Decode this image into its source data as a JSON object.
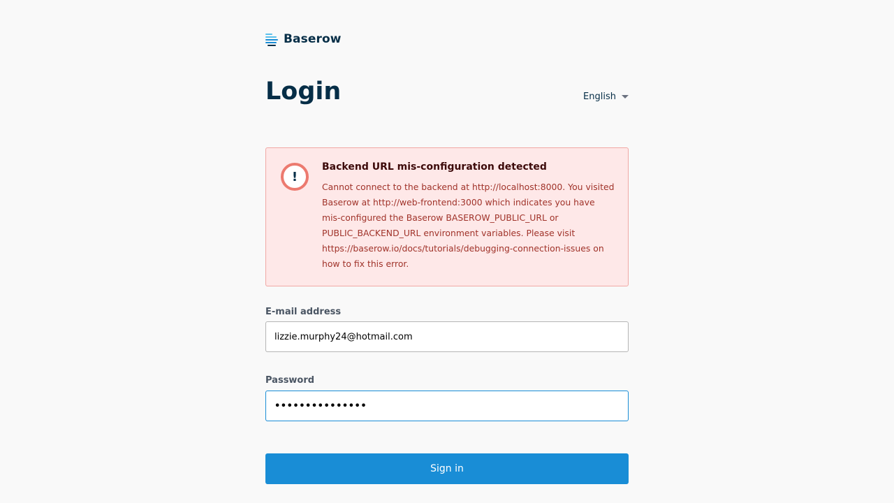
{
  "brand": {
    "name": "Baserow",
    "colors": [
      "#5bc0eb",
      "#198dd6",
      "#062e47"
    ]
  },
  "page": {
    "title": "Login"
  },
  "language": {
    "selected": "English"
  },
  "alert": {
    "icon": "exclamation-icon",
    "title": "Backend URL mis-configuration detected",
    "message": "Cannot connect to the backend at http://localhost:8000. You visited Baserow at http://web-frontend:3000 which indicates you have mis-configured the Baserow BASEROW_PUBLIC_URL or PUBLIC_BACKEND_URL environment variables. Please visit https://baserow.io/docs/tutorials/debugging-connection-issues on how to fix this error."
  },
  "form": {
    "email_label": "E-mail address",
    "email_value": "lizzie.murphy24@hotmail.com",
    "password_label": "Password",
    "password_value": "•••••••••••••••",
    "submit_label": "Sign in"
  },
  "colors": {
    "primary": "#198dd6",
    "alert_bg": "#fee8e8",
    "alert_border": "#f0a8a5",
    "alert_text": "#a0332a"
  }
}
